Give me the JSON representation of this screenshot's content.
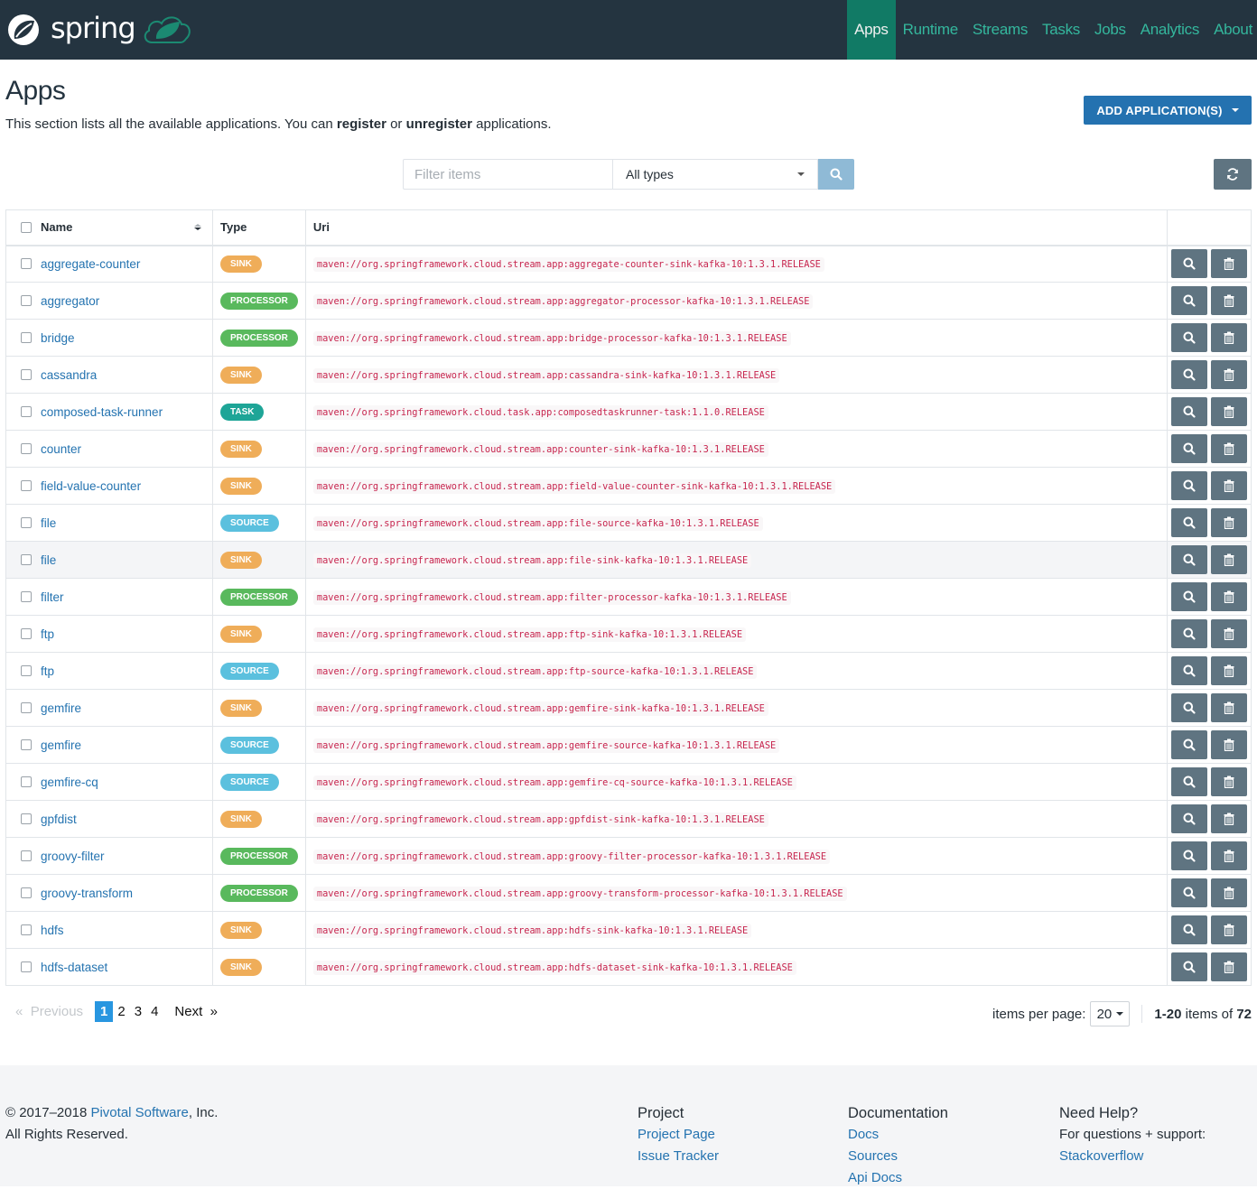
{
  "brand": {
    "name": "spring"
  },
  "nav": {
    "items": [
      {
        "label": "Apps",
        "active": true
      },
      {
        "label": "Runtime",
        "active": false
      },
      {
        "label": "Streams",
        "active": false
      },
      {
        "label": "Tasks",
        "active": false
      },
      {
        "label": "Jobs",
        "active": false
      },
      {
        "label": "Analytics",
        "active": false
      },
      {
        "label": "About",
        "active": false
      }
    ]
  },
  "page": {
    "title": "Apps",
    "desc_prefix": "This section lists all the available applications. You can ",
    "desc_register": "register",
    "desc_or": " or ",
    "desc_unregister": "unregister",
    "desc_suffix": " applications.",
    "add_button": "ADD APPLICATION(S)"
  },
  "filter": {
    "placeholder": "Filter items",
    "value": "",
    "type_selected": "All types"
  },
  "colors": {
    "sink": "#efad59",
    "processor": "#59b95d",
    "task": "#1ea597",
    "source": "#5bc0de",
    "accent": "#117a65",
    "primary": "#2472b0"
  },
  "table": {
    "headers": {
      "name": "Name",
      "type": "Type",
      "uri": "Uri"
    },
    "rows": [
      {
        "name": "aggregate-counter",
        "type": "SINK",
        "uri": "maven://org.springframework.cloud.stream.app:aggregate-counter-sink-kafka-10:1.3.1.RELEASE"
      },
      {
        "name": "aggregator",
        "type": "PROCESSOR",
        "uri": "maven://org.springframework.cloud.stream.app:aggregator-processor-kafka-10:1.3.1.RELEASE"
      },
      {
        "name": "bridge",
        "type": "PROCESSOR",
        "uri": "maven://org.springframework.cloud.stream.app:bridge-processor-kafka-10:1.3.1.RELEASE"
      },
      {
        "name": "cassandra",
        "type": "SINK",
        "uri": "maven://org.springframework.cloud.stream.app:cassandra-sink-kafka-10:1.3.1.RELEASE"
      },
      {
        "name": "composed-task-runner",
        "type": "TASK",
        "uri": "maven://org.springframework.cloud.task.app:composedtaskrunner-task:1.1.0.RELEASE"
      },
      {
        "name": "counter",
        "type": "SINK",
        "uri": "maven://org.springframework.cloud.stream.app:counter-sink-kafka-10:1.3.1.RELEASE"
      },
      {
        "name": "field-value-counter",
        "type": "SINK",
        "uri": "maven://org.springframework.cloud.stream.app:field-value-counter-sink-kafka-10:1.3.1.RELEASE"
      },
      {
        "name": "file",
        "type": "SOURCE",
        "uri": "maven://org.springframework.cloud.stream.app:file-source-kafka-10:1.3.1.RELEASE"
      },
      {
        "name": "file",
        "type": "SINK",
        "uri": "maven://org.springframework.cloud.stream.app:file-sink-kafka-10:1.3.1.RELEASE",
        "hover": true
      },
      {
        "name": "filter",
        "type": "PROCESSOR",
        "uri": "maven://org.springframework.cloud.stream.app:filter-processor-kafka-10:1.3.1.RELEASE"
      },
      {
        "name": "ftp",
        "type": "SINK",
        "uri": "maven://org.springframework.cloud.stream.app:ftp-sink-kafka-10:1.3.1.RELEASE"
      },
      {
        "name": "ftp",
        "type": "SOURCE",
        "uri": "maven://org.springframework.cloud.stream.app:ftp-source-kafka-10:1.3.1.RELEASE"
      },
      {
        "name": "gemfire",
        "type": "SINK",
        "uri": "maven://org.springframework.cloud.stream.app:gemfire-sink-kafka-10:1.3.1.RELEASE"
      },
      {
        "name": "gemfire",
        "type": "SOURCE",
        "uri": "maven://org.springframework.cloud.stream.app:gemfire-source-kafka-10:1.3.1.RELEASE"
      },
      {
        "name": "gemfire-cq",
        "type": "SOURCE",
        "uri": "maven://org.springframework.cloud.stream.app:gemfire-cq-source-kafka-10:1.3.1.RELEASE"
      },
      {
        "name": "gpfdist",
        "type": "SINK",
        "uri": "maven://org.springframework.cloud.stream.app:gpfdist-sink-kafka-10:1.3.1.RELEASE"
      },
      {
        "name": "groovy-filter",
        "type": "PROCESSOR",
        "uri": "maven://org.springframework.cloud.stream.app:groovy-filter-processor-kafka-10:1.3.1.RELEASE"
      },
      {
        "name": "groovy-transform",
        "type": "PROCESSOR",
        "uri": "maven://org.springframework.cloud.stream.app:groovy-transform-processor-kafka-10:1.3.1.RELEASE"
      },
      {
        "name": "hdfs",
        "type": "SINK",
        "uri": "maven://org.springframework.cloud.stream.app:hdfs-sink-kafka-10:1.3.1.RELEASE"
      },
      {
        "name": "hdfs-dataset",
        "type": "SINK",
        "uri": "maven://org.springframework.cloud.stream.app:hdfs-dataset-sink-kafka-10:1.3.1.RELEASE"
      }
    ]
  },
  "pagination": {
    "previous": "Previous",
    "next": "Next",
    "prev_glyph": "«",
    "next_glyph": "»",
    "pages": [
      "1",
      "2",
      "3",
      "4"
    ],
    "current": "1",
    "items_per_page_label": "items per page:",
    "items_per_page": "20",
    "range": "1-20",
    "range_mid": " items of ",
    "total": "72"
  },
  "footer": {
    "copyright_prefix": "© 2017–2018 ",
    "company": "Pivotal Software",
    "copyright_suffix": ", Inc.",
    "rights": "All Rights Reserved.",
    "columns": [
      {
        "title": "Project",
        "links": [
          "Project Page",
          "Issue Tracker"
        ]
      },
      {
        "title": "Documentation",
        "links": [
          "Docs",
          "Sources",
          "Api Docs"
        ]
      },
      {
        "title": "Need Help?",
        "text": "For questions + support:",
        "links": [
          "Stackoverflow"
        ]
      }
    ]
  }
}
